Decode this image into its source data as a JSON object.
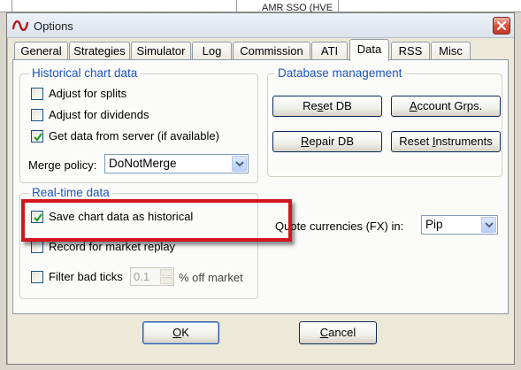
{
  "background": {
    "cell_text": "AMR SSO (HVE"
  },
  "window": {
    "title": "Options"
  },
  "tabs": [
    {
      "label": "General"
    },
    {
      "label": "Strategies"
    },
    {
      "label": "Simulator"
    },
    {
      "label": "Log"
    },
    {
      "label": "Commission"
    },
    {
      "label": "ATI"
    },
    {
      "label": "Data",
      "active": true
    },
    {
      "label": "RSS"
    },
    {
      "label": "Misc"
    }
  ],
  "historical": {
    "title": "Historical chart data",
    "adjust_splits": {
      "label": "Adjust for splits",
      "checked": false
    },
    "adjust_dividends": {
      "label": "Adjust for dividends",
      "checked": false
    },
    "get_from_server": {
      "label": "Get data from server (if available)",
      "checked": true
    },
    "merge_policy_label": "Merge policy:",
    "merge_policy_value": "DoNotMerge"
  },
  "database": {
    "title": "Database management",
    "reset_db": {
      "pre": "Re",
      "ul": "s",
      "post": "et DB"
    },
    "account_grps": {
      "pre": "",
      "ul": "A",
      "post": "ccount Grps."
    },
    "repair_db": {
      "pre": "",
      "ul": "R",
      "post": "epair DB"
    },
    "reset_instruments": {
      "pre": "Reset ",
      "ul": "I",
      "post": "nstruments"
    }
  },
  "realtime": {
    "title": "Real-time data",
    "save_historical": {
      "label": "Save chart data as historical",
      "checked": true
    },
    "record_replay": {
      "label": "Record for market replay",
      "checked": false
    },
    "filter_bad_ticks": {
      "label": "Filter bad ticks",
      "checked": false
    },
    "filter_value": "0.1",
    "filter_unit": "% off market"
  },
  "quote_currencies": {
    "label": "Quote currencies (FX) in:",
    "value": "Pip"
  },
  "footer": {
    "ok": {
      "pre": "",
      "ul": "O",
      "post": "K"
    },
    "cancel": {
      "pre": "",
      "ul": "C",
      "post": "ancel"
    }
  },
  "colors": {
    "group_title": "#1c55c2",
    "highlight": "#d1161d",
    "checkmark": "#21a121",
    "close_button": "#c23b24"
  }
}
